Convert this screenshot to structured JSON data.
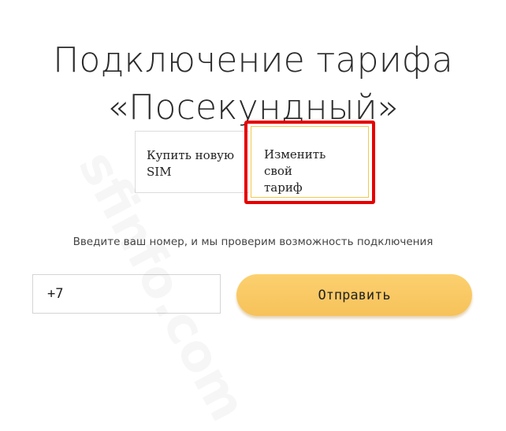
{
  "title": {
    "line1": "Подключение тарифа",
    "line2": "«Посекундный»"
  },
  "options": {
    "buy_sim": {
      "line1": "Купить новую",
      "line2": "SIM"
    },
    "change_tariff": {
      "line1": "Изменить свой",
      "line2": "тариф"
    }
  },
  "hint": "Введите ваш номер, и мы проверим возможность подключения",
  "phone": {
    "value": "+7"
  },
  "submit_label": "Отправить",
  "watermark": "sfinfo.com",
  "colors": {
    "accent": "#f6c25a",
    "highlight": "#e60000",
    "selected_border": "#f2c84a"
  }
}
